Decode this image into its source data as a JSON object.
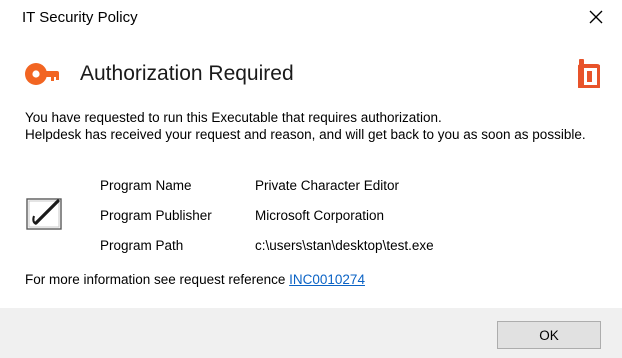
{
  "window": {
    "title": "IT Security Policy",
    "close_icon": "close-icon"
  },
  "header": {
    "title": "Authorization Required",
    "left_icon": "authorization-key-icon",
    "right_icon": "brand-logo-icon",
    "accent_color": "#f26522"
  },
  "message": {
    "line1": "You have requested to run this Executable that requires authorization.",
    "line2": "Helpdesk has received your request and reason, and will get back to you as soon as possible."
  },
  "program": {
    "icon": "program-editor-icon",
    "rows": [
      {
        "label": "Program Name",
        "value": "Private Character Editor"
      },
      {
        "label": "Program Publisher",
        "value": "Microsoft Corporation"
      },
      {
        "label": "Program Path",
        "value": "c:\\users\\stan\\desktop\\test.exe"
      }
    ]
  },
  "reference": {
    "text": "For more information see request reference",
    "link": "INC0010274",
    "link_color": "#0b63c5"
  },
  "footer": {
    "ok_label": "OK"
  }
}
